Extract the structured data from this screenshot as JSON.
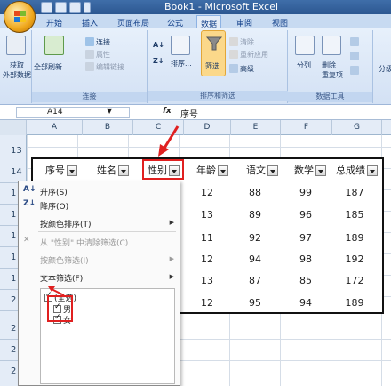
{
  "titlebar": {
    "title": "Book1 - Microsoft Excel"
  },
  "tabs": [
    {
      "label": "开始"
    },
    {
      "label": "插入"
    },
    {
      "label": "页面布局"
    },
    {
      "label": "公式"
    },
    {
      "label": "数据"
    },
    {
      "label": "审阅"
    },
    {
      "label": "视图"
    }
  ],
  "ribbon": {
    "get_external": "获取\n外部数据",
    "refresh_all": "全部刷新",
    "connections": "连接",
    "properties": "属性",
    "edit_links": "编辑链接",
    "group_connections": "连接",
    "sort": "排序...",
    "filter": "筛选",
    "clear": "清除",
    "reapply": "重新应用",
    "advanced": "高级",
    "group_sort_filter": "排序和筛选",
    "text_to_columns": "分列",
    "remove_duplicates": "删除\n重复项",
    "group_data_tools": "数据工具",
    "partial_right": "分级"
  },
  "formula_bar": {
    "cell_ref": "A14",
    "fx": "fx",
    "value": "序号"
  },
  "columns": [
    "A",
    "B",
    "C",
    "D",
    "E",
    "F",
    "G"
  ],
  "rows": [
    "13",
    "14",
    "1",
    "1",
    "1",
    "1",
    "1",
    "2",
    "2",
    "2",
    "2"
  ],
  "table": {
    "headers": [
      "序号",
      "姓名",
      "性别",
      "年龄",
      "语文",
      "数学",
      "总成绩"
    ],
    "rows": [
      [
        "12",
        "88",
        "99",
        "187"
      ],
      [
        "13",
        "89",
        "96",
        "185"
      ],
      [
        "11",
        "92",
        "97",
        "189"
      ],
      [
        "12",
        "94",
        "98",
        "192"
      ],
      [
        "13",
        "87",
        "85",
        "172"
      ],
      [
        "12",
        "95",
        "94",
        "189"
      ]
    ]
  },
  "filter_menu": {
    "sort_asc": "升序(S)",
    "sort_desc": "降序(O)",
    "sort_by_color": "按颜色排序(T)",
    "clear_filter": "从 \"性别\" 中清除筛选(C)",
    "filter_by_color": "按颜色筛选(I)",
    "text_filters": "文本筛选(F)",
    "select_all": "(全选)",
    "options": [
      "男",
      "女"
    ]
  },
  "colors": {
    "accent_red": "#e02020",
    "ribbon_blue": "#d3e1f4"
  }
}
